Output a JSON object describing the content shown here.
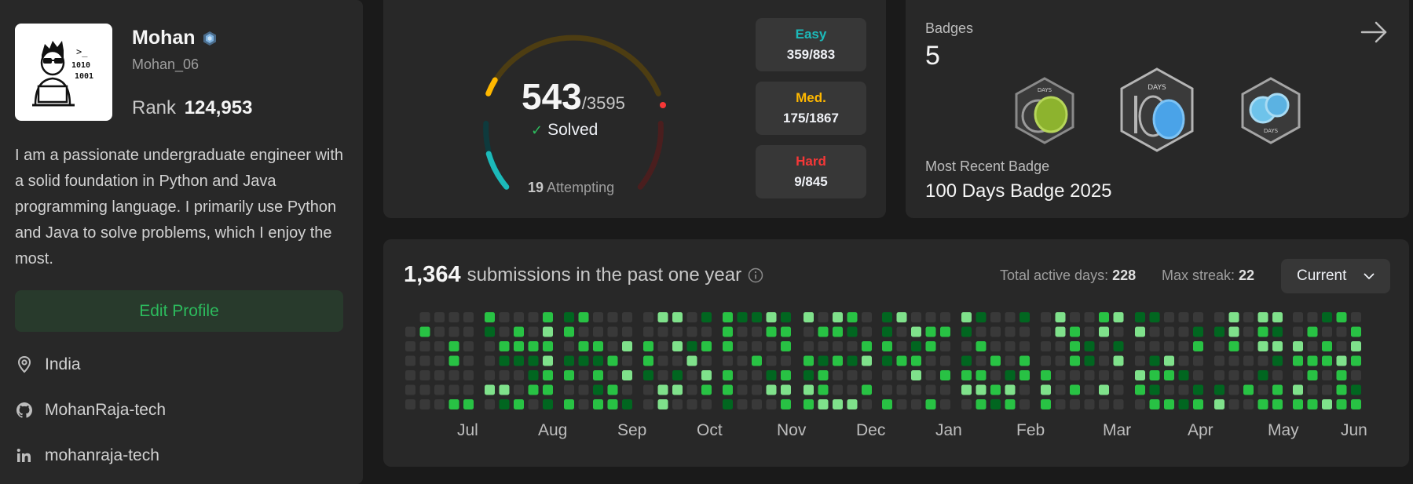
{
  "profile": {
    "name": "Mohan",
    "username": "Mohan_06",
    "rank_label": "Rank",
    "rank_value": "124,953",
    "bio": "I am a passionate undergraduate engineer with a solid foundation in Python and Java programming language. I primarily use Python and Java to solve problems, which I enjoy the most.",
    "edit_button": "Edit Profile",
    "location": "India",
    "github": "MohanRaja-tech",
    "linkedin": "mohanraja-tech",
    "avatar_text": ">_\n1010\n1001"
  },
  "progress": {
    "solved": "543",
    "total": "/3595",
    "solved_label": "Solved",
    "attempting_count": "19",
    "attempting_label": "Attempting",
    "difficulties": [
      {
        "label": "Easy",
        "value": "359/883",
        "color": "#1cbaba"
      },
      {
        "label": "Med.",
        "value": "175/1867",
        "color": "#ffb800"
      },
      {
        "label": "Hard",
        "value": "9/845",
        "color": "#f63737"
      }
    ]
  },
  "badges": {
    "title": "Badges",
    "count": "5",
    "badge_text": "DAYS",
    "recent_label": "Most Recent Badge",
    "recent_name": "100 Days Badge 2025"
  },
  "submissions": {
    "count": "1,364",
    "label": "submissions in the past one year",
    "active_label": "Total active days:",
    "active_value": "228",
    "streak_label": "Max streak:",
    "streak_value": "22",
    "select_value": "Current",
    "months": [
      "Jul",
      "Aug",
      "Sep",
      "Oct",
      "Nov",
      "Dec",
      "Jan",
      "Feb",
      "Mar",
      "Apr",
      "May",
      "Jun"
    ],
    "colors": {
      "empty": "#393939",
      "level1": "#016620",
      "level2": "#28c244",
      "level3": "#7fe18b"
    }
  },
  "colors": {
    "accent_green": "#2cbb5d",
    "easy": "#1cbaba",
    "medium": "#ffb800",
    "hard": "#f63737"
  }
}
